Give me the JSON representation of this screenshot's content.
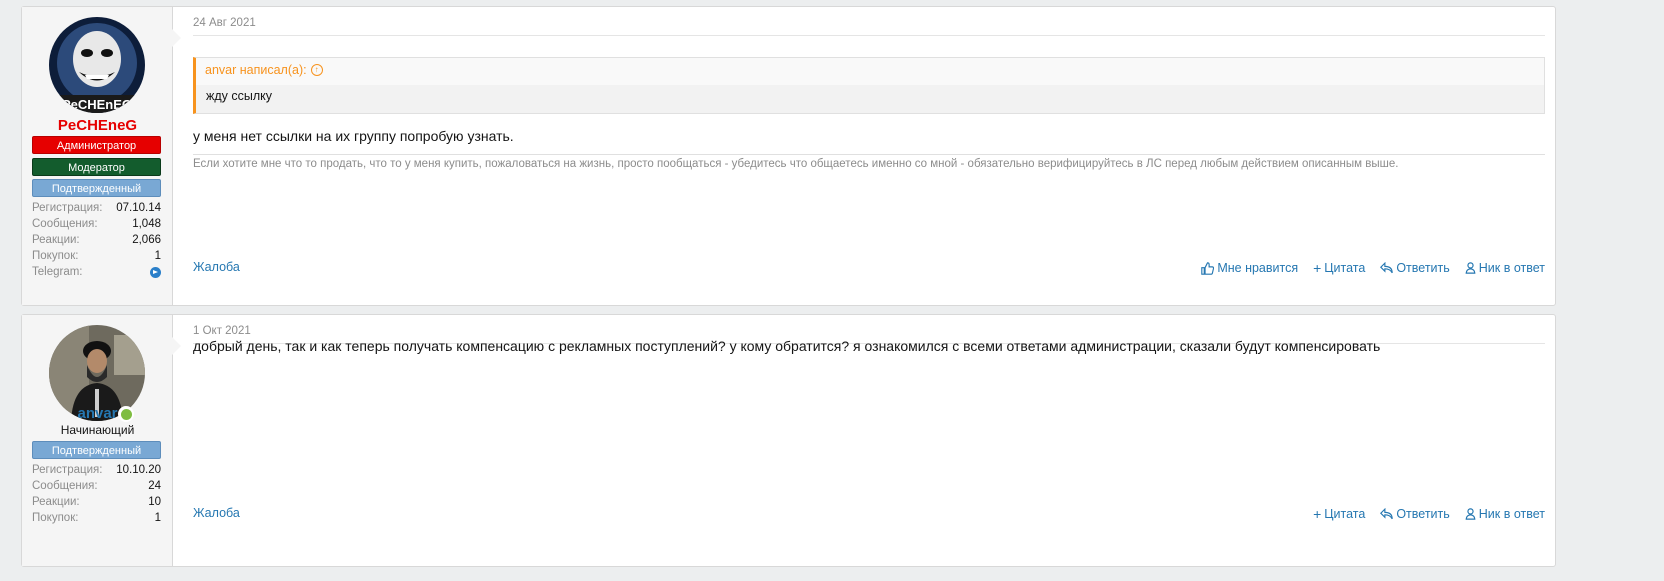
{
  "posts": [
    {
      "user": {
        "name": "PeCHEneG",
        "name_color": "#e60000",
        "banners": [
          "Администратор",
          "Модератор",
          "Подтвержденный"
        ],
        "stats": [
          {
            "k": "Регистрация:",
            "v": "07.10.14"
          },
          {
            "k": "Сообщения:",
            "v": "1,048"
          },
          {
            "k": "Реакции:",
            "v": "2,066"
          },
          {
            "k": "Покупок:",
            "v": "1"
          },
          {
            "k": "Telegram:",
            "icon": "telegram-icon"
          }
        ]
      },
      "date": "24 Авг 2021",
      "quote": {
        "author": "anvar написал(а):",
        "text": "жду ссылку"
      },
      "message": "у меня нет ссылки на их группу попробую узнать.",
      "signature": "Если хотите мне что то продать, что то у меня купить, пожаловаться на жизнь, просто пообщаться - убедитесь что общаетесь именно со мной - обязательно верифицируйтесь в ЛС перед любым действием описанным выше.",
      "actions": {
        "report": "Жалоба",
        "like": "Мне нравится",
        "quote": "Цитата",
        "reply": "Ответить",
        "mention": "Ник в ответ"
      }
    },
    {
      "user": {
        "name": "anvar",
        "name_color": "#2577b1",
        "title": "Начинающий",
        "banners": [
          "Подтвержденный"
        ],
        "stats": [
          {
            "k": "Регистрация:",
            "v": "10.10.20"
          },
          {
            "k": "Сообщения:",
            "v": "24"
          },
          {
            "k": "Реакции:",
            "v": "10"
          },
          {
            "k": "Покупок:",
            "v": "1"
          }
        ]
      },
      "date": "1 Окт 2021",
      "message": "добрый день, так и как теперь получать компенсацию с рекламных поступлений? у кому обратится? я ознакомился с всеми ответами администрации, сказали будут компенсировать",
      "actions": {
        "report": "Жалоба",
        "quote": "Цитата",
        "reply": "Ответить",
        "mention": "Ник в ответ"
      }
    }
  ]
}
